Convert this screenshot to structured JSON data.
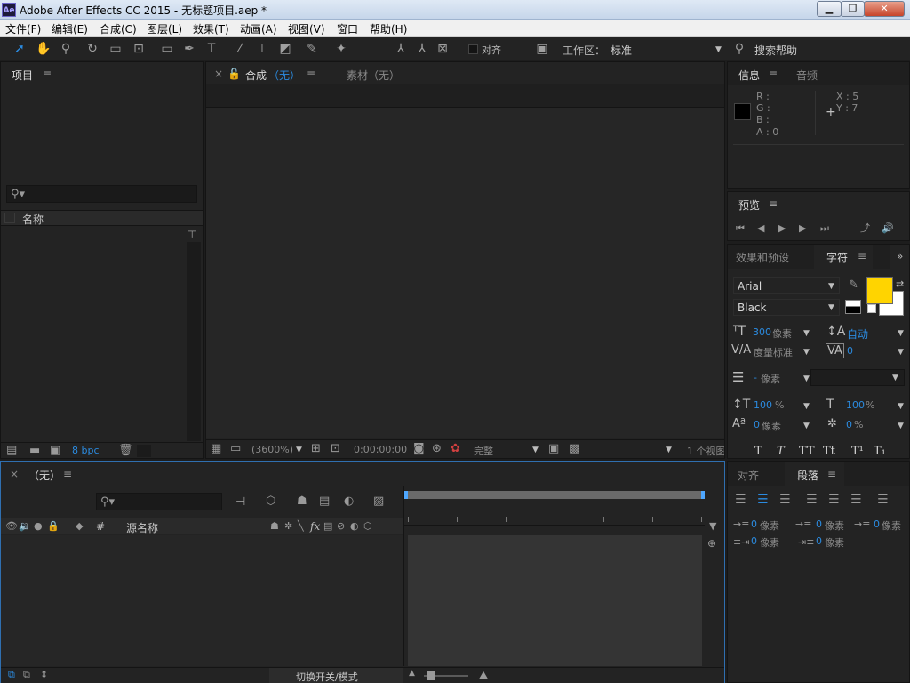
{
  "window": {
    "logo": "Ae",
    "title": "Adobe After Effects CC 2015 - 无标题项目.aep *",
    "minimize": "▁",
    "maximize": "❐",
    "close": "✕"
  },
  "menubar": [
    "文件(F)",
    "编辑(E)",
    "合成(C)",
    "图层(L)",
    "效果(T)",
    "动画(A)",
    "视图(V)",
    "窗口",
    "帮助(H)"
  ],
  "toolbar": {
    "snap_label": "对齐",
    "workspace_label": "工作区：",
    "workspace_value": "标准",
    "search_help": "搜索帮助"
  },
  "project_panel": {
    "tab": "项目",
    "col_name": "名称",
    "bpc": "8 bpc"
  },
  "comp_panel": {
    "tab_close": "×",
    "tab_comp": "合成",
    "tab_comp_value": "（无）",
    "tab_footage": "素材（无）",
    "zoom": "(3600%)",
    "timecode": "0:00:00:00",
    "quality": "完整",
    "views": "1 个视图"
  },
  "info_panel": {
    "tab_info": "信息",
    "tab_audio": "音频",
    "r": "R :",
    "g": "G :",
    "b": "B :",
    "a": "A : 0",
    "x": "X : 5",
    "y": "Y : 7"
  },
  "preview_panel": {
    "tab": "预览"
  },
  "character_panel": {
    "tab_effects": "效果和预设",
    "tab_char": "字符",
    "font": "Arial",
    "style": "Black",
    "size_value": "300",
    "size_unit": "像素",
    "leading_value": "自动",
    "kerning": "度量标准",
    "tracking_value": "0",
    "stroke_value": "-",
    "stroke_unit": "像素",
    "vscale_value": "100",
    "vscale_unit": "%",
    "hscale_value": "100",
    "hscale_unit": "%",
    "baseline_value": "0",
    "baseline_unit": "像素",
    "tsume_value": "0",
    "tsume_unit": "%",
    "styles": [
      "T",
      "T",
      "TT",
      "Tt",
      "T¹",
      "T₁"
    ],
    "fill_color": "#ffd400"
  },
  "paragraph_panel": {
    "tab_align": "对齐",
    "tab_para": "段落",
    "indent_left": "0",
    "indent_first": "0",
    "indent_right": "0",
    "space_before": "0",
    "space_after": "0",
    "unit": "像素"
  },
  "timeline_panel": {
    "tab_close": "×",
    "tab": "（无）",
    "col_num": "#",
    "col_source": "源名称",
    "toggle_label": "切换开关/模式"
  }
}
